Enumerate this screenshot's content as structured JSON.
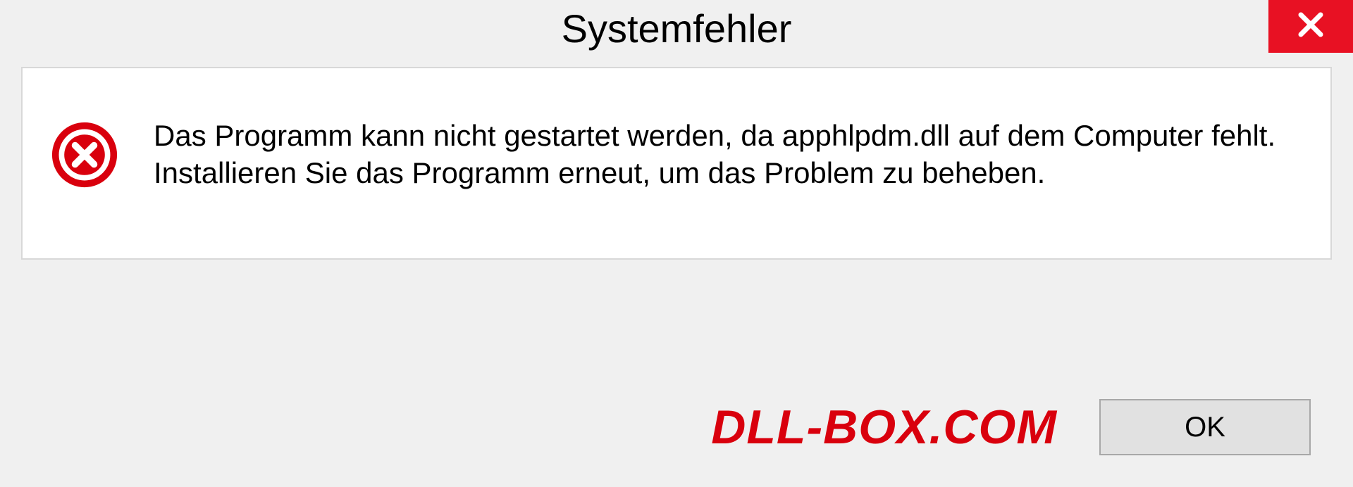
{
  "dialog": {
    "title": "Systemfehler",
    "message": "Das Programm kann nicht gestartet werden, da apphlpdm.dll auf dem Computer fehlt. Installieren Sie das Programm erneut, um das Problem zu beheben.",
    "ok_label": "OK"
  },
  "watermark": "DLL-BOX.COM",
  "colors": {
    "close_bg": "#e81123",
    "watermark": "#d9000d",
    "error_icon": "#d9000d"
  }
}
